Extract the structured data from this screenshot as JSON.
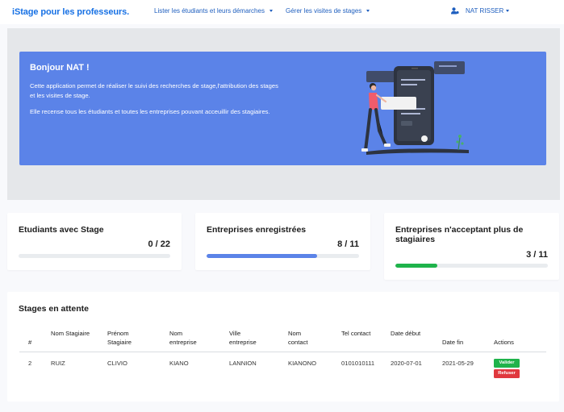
{
  "navbar": {
    "brand": "iStage pour les professeurs.",
    "menu1": "Lister les étudiants et leurs démarches",
    "menu2": "Gérer les visites de stages",
    "user": "NAT RISSER"
  },
  "hero": {
    "title": "Bonjour NAT !",
    "p1": "Cette application permet de réaliser le suivi des recherches de stage,l'attribution des stages et les visites de stage.",
    "p2": "Elle recense tous les étudiants et toutes les entreprises pouvant acceuillir des stagiaires."
  },
  "stats": [
    {
      "title": "Etudiants avec Stage",
      "value": "0 / 22",
      "progress": 0,
      "color": "#5b83e8"
    },
    {
      "title": "Entreprises enregistrées",
      "value": "8 / 11",
      "progress": 0.727,
      "color": "#5b83e8"
    },
    {
      "title": "Entreprises n'acceptant plus de stagiaires",
      "value": "3 / 11",
      "progress": 0.273,
      "color": "#1fb34b"
    }
  ],
  "pending": {
    "title": "Stages en attente",
    "headers": [
      "#",
      "Nom Stagiaire",
      "Prénom Stagiaire",
      "Nom entreprise",
      "Ville entreprise",
      "Nom contact",
      "Tel contact",
      "Date début",
      "Date fin",
      "Actions"
    ],
    "rows": [
      {
        "num": "2",
        "nom": "RUIZ",
        "prenom": "CLIVIO",
        "entreprise": "KIANO",
        "ville": "LANNION",
        "contact": "KIANONO",
        "tel": "0101010111",
        "debut": "2020-07-01",
        "fin": "2021-05-29"
      }
    ],
    "validate_label": "Valider",
    "refuse_label": "Refuser"
  }
}
